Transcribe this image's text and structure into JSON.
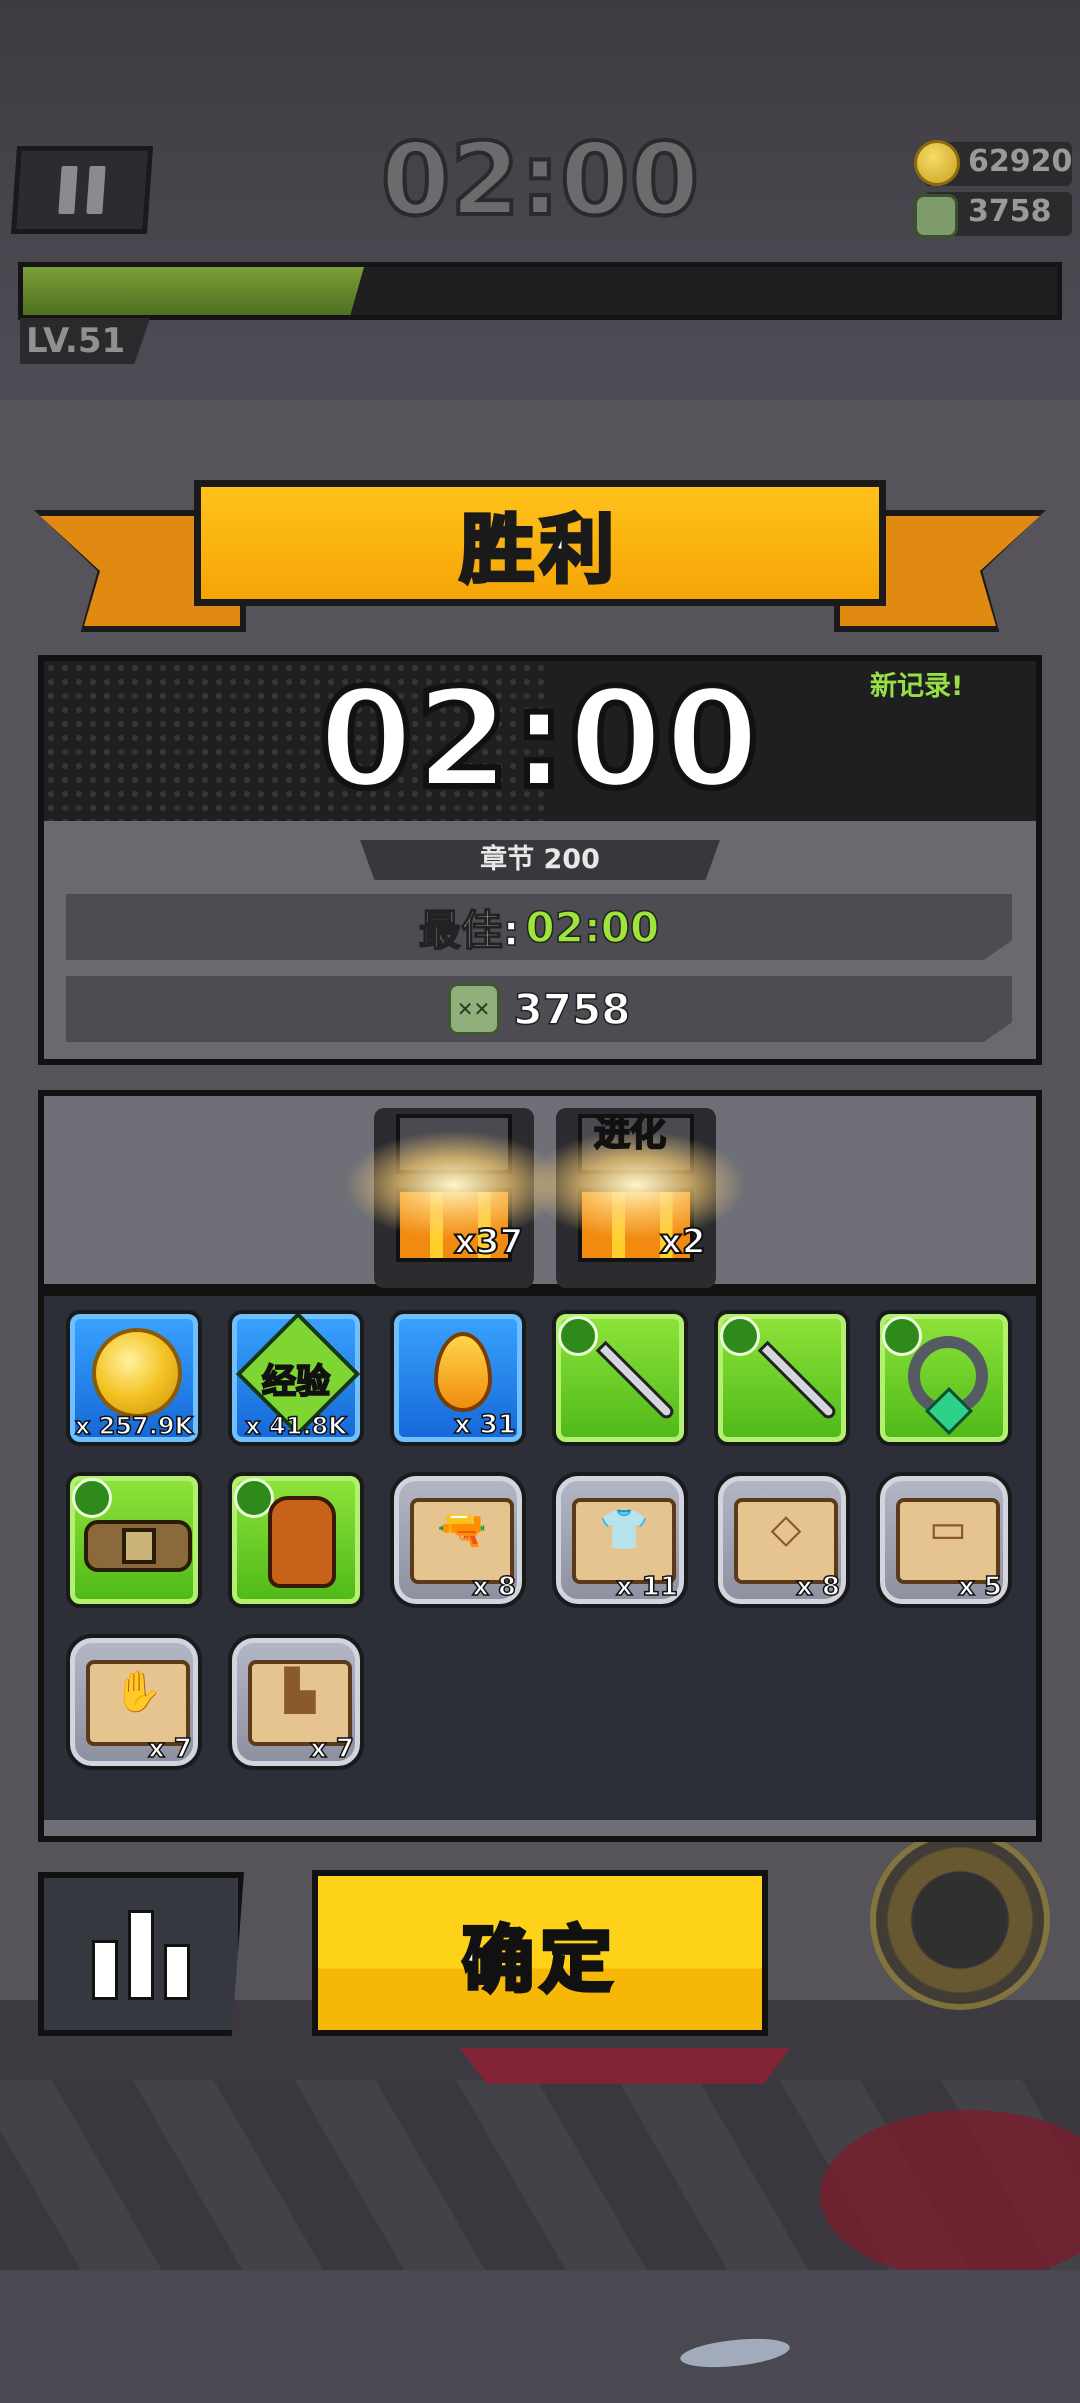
{
  "hud": {
    "timer": "02:00",
    "gold": "62920",
    "kills": "3758",
    "level": "LV.51",
    "xp_fill_fraction": 0.33
  },
  "banner": {
    "title": "胜利"
  },
  "result": {
    "time": "02:00",
    "new_record": "新记录!",
    "chapter": "章节 200",
    "best_label": "最佳:",
    "best_time": "02:00",
    "kills": "3758"
  },
  "chests": [
    {
      "count": "x37",
      "label": ""
    },
    {
      "count": "x2",
      "label": "进化"
    }
  ],
  "rewards": [
    {
      "type": "coin",
      "qty": "x 257.9K",
      "rarity": "blue"
    },
    {
      "type": "exp",
      "label": "经验",
      "qty": "x 41.8K",
      "rarity": "blue"
    },
    {
      "type": "essence",
      "qty": "x 31",
      "rarity": "blue"
    },
    {
      "type": "sword",
      "qty": "",
      "rarity": "green"
    },
    {
      "type": "sword",
      "qty": "",
      "rarity": "green"
    },
    {
      "type": "necklace",
      "qty": "",
      "rarity": "green"
    },
    {
      "type": "belt",
      "qty": "",
      "rarity": "green"
    },
    {
      "type": "glove",
      "qty": "",
      "rarity": "green"
    },
    {
      "type": "scroll-gun",
      "qty": "x 8",
      "rarity": "gray"
    },
    {
      "type": "scroll-armor",
      "qty": "x 11",
      "rarity": "gray"
    },
    {
      "type": "scroll-necklace",
      "qty": "x 8",
      "rarity": "gray"
    },
    {
      "type": "scroll-belt",
      "qty": "x 5",
      "rarity": "gray"
    },
    {
      "type": "scroll-glove",
      "qty": "x 7",
      "rarity": "gray"
    },
    {
      "type": "scroll-boots",
      "qty": "x 7",
      "rarity": "gray"
    }
  ],
  "buttons": {
    "confirm": "确定"
  },
  "colors": {
    "accent": "#f5a506",
    "record_green": "#96e046",
    "best_green": "#9ee53a"
  }
}
